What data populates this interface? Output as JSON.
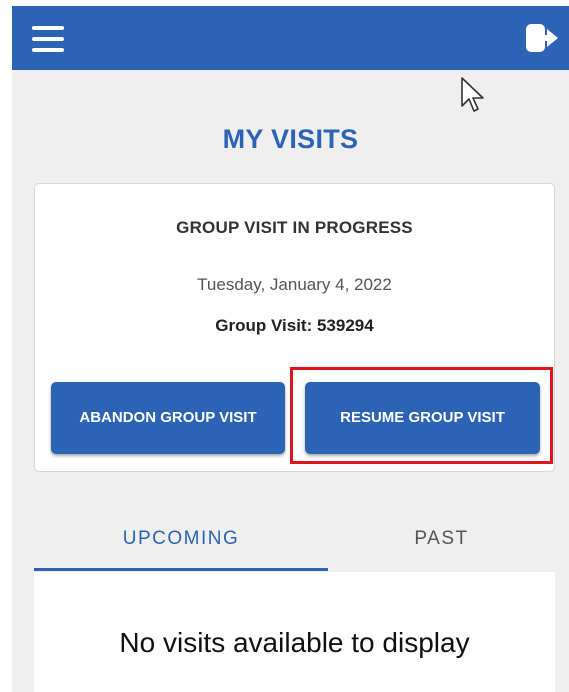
{
  "app": {
    "theme": {
      "primary": "#2c63b5",
      "highlight": "#e0141e",
      "background": "#efefef"
    },
    "header": {
      "menu_icon": "hamburger-menu-icon",
      "logout_icon": "logout-icon"
    }
  },
  "page": {
    "title": "MY VISITS"
  },
  "visit_card": {
    "heading": "GROUP VISIT IN PROGRESS",
    "date": "Tuesday, January 4, 2022",
    "visit_id_label": "Group Visit: 539294",
    "abandon_label": "ABANDON GROUP VISIT",
    "resume_label": "RESUME GROUP VISIT"
  },
  "tabs": [
    {
      "label": "UPCOMING",
      "selected": true
    },
    {
      "label": "PAST",
      "selected": false
    }
  ],
  "list": {
    "empty_message": "No visits available to display"
  }
}
